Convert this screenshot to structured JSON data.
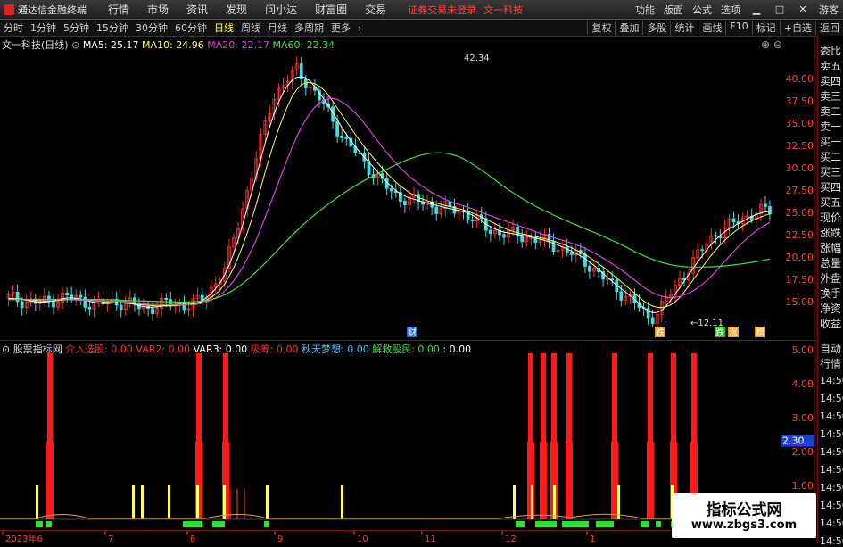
{
  "menubar": {
    "app_title": "通达信金融终端",
    "menus": [
      "行情",
      "市场",
      "资讯",
      "发现",
      "问小达",
      "财富圈",
      "交易"
    ],
    "notice": "证券交易未登录",
    "notice2": "文一科技",
    "right": [
      "功能",
      "版面",
      "公式",
      "选项"
    ],
    "mode": "游客"
  },
  "toolbar": {
    "periods": [
      "分时",
      "1分钟",
      "5分钟",
      "15分钟",
      "30分钟",
      "60分钟",
      "日线",
      "周线",
      "月线",
      "多周期",
      "更多"
    ],
    "active": "日线",
    "right": [
      "复权",
      "叠加",
      "多股",
      "统计",
      "画线",
      "F10",
      "标记",
      "+自选",
      "返回"
    ]
  },
  "chart_header": {
    "stock": "文一科技(日线)",
    "ma": [
      {
        "label": "MA5: 25.17",
        "color": "#ffffff"
      },
      {
        "label": "MA10: 24.96",
        "color": "#ffff55"
      },
      {
        "label": "MA20: 22.17",
        "color": "#e040e0"
      },
      {
        "label": "MA60: 22.34",
        "color": "#40e040"
      }
    ]
  },
  "price_axis": [
    "40.00",
    "37.50",
    "35.00",
    "32.50",
    "30.00",
    "27.50",
    "25.00",
    "22.50",
    "20.00",
    "17.50",
    "15.00"
  ],
  "annotations": {
    "high": "42.34",
    "low": "12.11",
    "cai": "财",
    "die": "跌",
    "zhang": "涨",
    "xiang": "赠"
  },
  "indicator_header": {
    "name": "股票指标网",
    "items": [
      {
        "label": "介入选股: 0.00",
        "color": "#ff3030"
      },
      {
        "label": "VAR2: 0.00",
        "color": "#ff3030"
      },
      {
        "label": "VAR3: 0.00",
        "color": "#ffffff"
      },
      {
        "label": "吸筹: 0.00",
        "color": "#ff3030"
      },
      {
        "label": "秋天梦想: 0.00",
        "color": "#40c0ff"
      },
      {
        "label": "解救股民: 0.00",
        "color": "#40e040"
      },
      {
        "label": ": 0.00",
        "color": "#ffffff"
      }
    ]
  },
  "indicator_axis": [
    "5.00",
    "4.00",
    "3.00",
    "2.00",
    "1.00"
  ],
  "indicator_current": "2.30",
  "x_axis": [
    "2023年6",
    "7",
    "8",
    "9",
    "10",
    "11",
    "12",
    "1"
  ],
  "right_panel": [
    "委比",
    "卖五",
    "卖四",
    "卖三",
    "卖二",
    "卖一",
    "买一",
    "买二",
    "买三",
    "买四",
    "买五",
    "现价",
    "涨跌",
    "涨幅",
    "总量",
    "外盘",
    "换手",
    "净资",
    "收益",
    "自动",
    "行情",
    "14:50",
    "14:50",
    "14:50",
    "14:50",
    "14:50",
    "14:50",
    "14:50",
    "14:50",
    "14:50",
    "14:50"
  ],
  "watermark": {
    "line1": "指标公式网",
    "line2": "www.zbgs3.com"
  },
  "colors": {
    "up": "#ff3030",
    "down": "#40e0e0",
    "grid": "#7a1010",
    "ma5": "#ffffff",
    "ma10": "#ffff55",
    "ma20": "#e040e0",
    "ma60": "#40e040",
    "bar": "#ff1a1a",
    "yellow": "#ffff55",
    "green": "#30e030"
  }
}
